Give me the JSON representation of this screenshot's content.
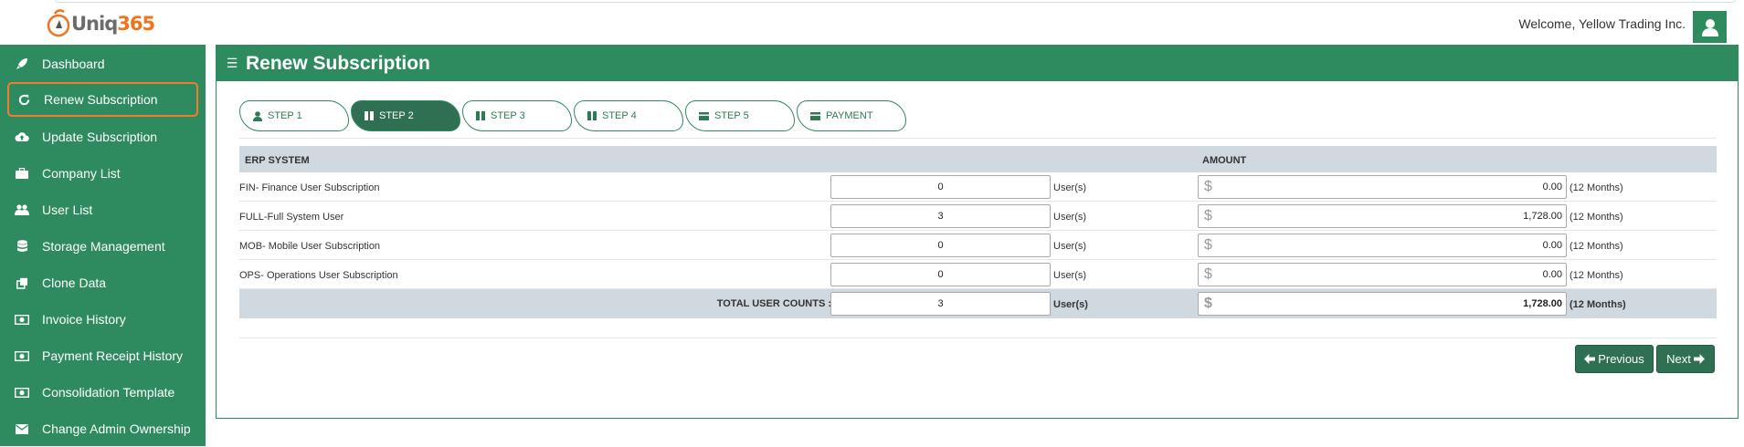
{
  "header": {
    "logo_text_a": "Uniq",
    "logo_text_b": "365",
    "welcome": "Welcome, Yellow Trading Inc."
  },
  "sidebar": {
    "items": [
      {
        "label": "Dashboard",
        "icon": "rocket-icon"
      },
      {
        "label": "Renew Subscription",
        "icon": "refresh-icon",
        "active": true
      },
      {
        "label": "Update Subscription",
        "icon": "cloud-upload-icon"
      },
      {
        "label": "Company List",
        "icon": "briefcase-icon"
      },
      {
        "label": "User List",
        "icon": "users-icon"
      },
      {
        "label": "Storage Management",
        "icon": "database-icon"
      },
      {
        "label": "Clone Data",
        "icon": "clone-icon"
      },
      {
        "label": "Invoice History",
        "icon": "money-icon"
      },
      {
        "label": "Payment Receipt History",
        "icon": "money-icon"
      },
      {
        "label": "Consolidation Template",
        "icon": "money-icon"
      },
      {
        "label": "Change Admin Ownership",
        "icon": "envelope-icon"
      }
    ]
  },
  "page": {
    "title": "Renew Subscription",
    "steps": [
      {
        "label": "STEP 1",
        "icon": "user-icon"
      },
      {
        "label": "STEP 2",
        "icon": "columns-icon",
        "active": true
      },
      {
        "label": "STEP 3",
        "icon": "columns-icon"
      },
      {
        "label": "STEP 4",
        "icon": "columns-icon"
      },
      {
        "label": "STEP 5",
        "icon": "credit-card-icon"
      },
      {
        "label": "PAYMENT",
        "icon": "credit-card-icon"
      }
    ],
    "table": {
      "col_system": "ERP SYSTEM",
      "col_amount": "AMOUNT",
      "users_suffix": "User(s)",
      "months_suffix": "(12 Months)",
      "currency": "$",
      "rows": [
        {
          "name": "FIN- Finance User Subscription",
          "qty": "0",
          "amount": "0.00"
        },
        {
          "name": "FULL-Full System User",
          "qty": "3",
          "amount": "1,728.00"
        },
        {
          "name": "MOB- Mobile User Subscription",
          "qty": "0",
          "amount": "0.00"
        },
        {
          "name": "OPS- Operations User Subscription",
          "qty": "0",
          "amount": "0.00"
        }
      ],
      "total": {
        "label": "TOTAL USER COUNTS :",
        "qty": "3",
        "amount": "1,728.00"
      }
    },
    "buttons": {
      "previous": "Previous",
      "next": "Next"
    }
  },
  "colors": {
    "brand_green": "#2e8b5f",
    "active_border": "#f07c2e",
    "step_active": "#2e7051"
  }
}
